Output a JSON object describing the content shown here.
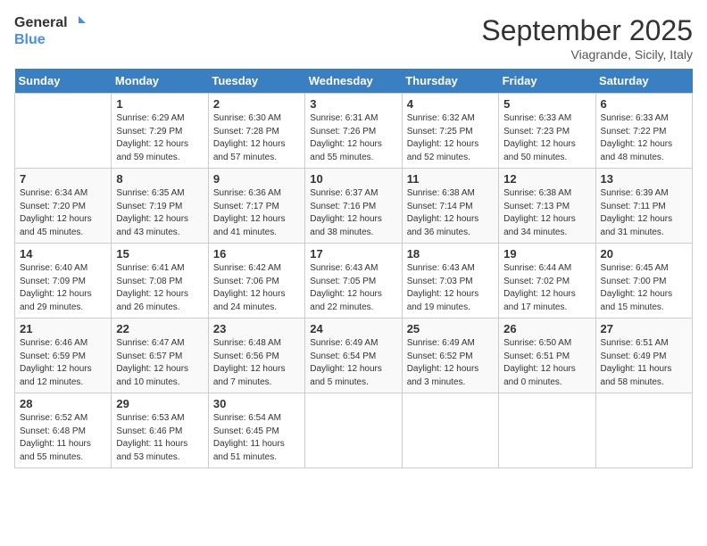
{
  "logo": {
    "general": "General",
    "blue": "Blue"
  },
  "title": "September 2025",
  "location": "Viagrande, Sicily, Italy",
  "weekdays": [
    "Sunday",
    "Monday",
    "Tuesday",
    "Wednesday",
    "Thursday",
    "Friday",
    "Saturday"
  ],
  "weeks": [
    [
      {
        "day": "",
        "info": ""
      },
      {
        "day": "1",
        "info": "Sunrise: 6:29 AM\nSunset: 7:29 PM\nDaylight: 12 hours\nand 59 minutes."
      },
      {
        "day": "2",
        "info": "Sunrise: 6:30 AM\nSunset: 7:28 PM\nDaylight: 12 hours\nand 57 minutes."
      },
      {
        "day": "3",
        "info": "Sunrise: 6:31 AM\nSunset: 7:26 PM\nDaylight: 12 hours\nand 55 minutes."
      },
      {
        "day": "4",
        "info": "Sunrise: 6:32 AM\nSunset: 7:25 PM\nDaylight: 12 hours\nand 52 minutes."
      },
      {
        "day": "5",
        "info": "Sunrise: 6:33 AM\nSunset: 7:23 PM\nDaylight: 12 hours\nand 50 minutes."
      },
      {
        "day": "6",
        "info": "Sunrise: 6:33 AM\nSunset: 7:22 PM\nDaylight: 12 hours\nand 48 minutes."
      }
    ],
    [
      {
        "day": "7",
        "info": "Sunrise: 6:34 AM\nSunset: 7:20 PM\nDaylight: 12 hours\nand 45 minutes."
      },
      {
        "day": "8",
        "info": "Sunrise: 6:35 AM\nSunset: 7:19 PM\nDaylight: 12 hours\nand 43 minutes."
      },
      {
        "day": "9",
        "info": "Sunrise: 6:36 AM\nSunset: 7:17 PM\nDaylight: 12 hours\nand 41 minutes."
      },
      {
        "day": "10",
        "info": "Sunrise: 6:37 AM\nSunset: 7:16 PM\nDaylight: 12 hours\nand 38 minutes."
      },
      {
        "day": "11",
        "info": "Sunrise: 6:38 AM\nSunset: 7:14 PM\nDaylight: 12 hours\nand 36 minutes."
      },
      {
        "day": "12",
        "info": "Sunrise: 6:38 AM\nSunset: 7:13 PM\nDaylight: 12 hours\nand 34 minutes."
      },
      {
        "day": "13",
        "info": "Sunrise: 6:39 AM\nSunset: 7:11 PM\nDaylight: 12 hours\nand 31 minutes."
      }
    ],
    [
      {
        "day": "14",
        "info": "Sunrise: 6:40 AM\nSunset: 7:09 PM\nDaylight: 12 hours\nand 29 minutes."
      },
      {
        "day": "15",
        "info": "Sunrise: 6:41 AM\nSunset: 7:08 PM\nDaylight: 12 hours\nand 26 minutes."
      },
      {
        "day": "16",
        "info": "Sunrise: 6:42 AM\nSunset: 7:06 PM\nDaylight: 12 hours\nand 24 minutes."
      },
      {
        "day": "17",
        "info": "Sunrise: 6:43 AM\nSunset: 7:05 PM\nDaylight: 12 hours\nand 22 minutes."
      },
      {
        "day": "18",
        "info": "Sunrise: 6:43 AM\nSunset: 7:03 PM\nDaylight: 12 hours\nand 19 minutes."
      },
      {
        "day": "19",
        "info": "Sunrise: 6:44 AM\nSunset: 7:02 PM\nDaylight: 12 hours\nand 17 minutes."
      },
      {
        "day": "20",
        "info": "Sunrise: 6:45 AM\nSunset: 7:00 PM\nDaylight: 12 hours\nand 15 minutes."
      }
    ],
    [
      {
        "day": "21",
        "info": "Sunrise: 6:46 AM\nSunset: 6:59 PM\nDaylight: 12 hours\nand 12 minutes."
      },
      {
        "day": "22",
        "info": "Sunrise: 6:47 AM\nSunset: 6:57 PM\nDaylight: 12 hours\nand 10 minutes."
      },
      {
        "day": "23",
        "info": "Sunrise: 6:48 AM\nSunset: 6:56 PM\nDaylight: 12 hours\nand 7 minutes."
      },
      {
        "day": "24",
        "info": "Sunrise: 6:49 AM\nSunset: 6:54 PM\nDaylight: 12 hours\nand 5 minutes."
      },
      {
        "day": "25",
        "info": "Sunrise: 6:49 AM\nSunset: 6:52 PM\nDaylight: 12 hours\nand 3 minutes."
      },
      {
        "day": "26",
        "info": "Sunrise: 6:50 AM\nSunset: 6:51 PM\nDaylight: 12 hours\nand 0 minutes."
      },
      {
        "day": "27",
        "info": "Sunrise: 6:51 AM\nSunset: 6:49 PM\nDaylight: 11 hours\nand 58 minutes."
      }
    ],
    [
      {
        "day": "28",
        "info": "Sunrise: 6:52 AM\nSunset: 6:48 PM\nDaylight: 11 hours\nand 55 minutes."
      },
      {
        "day": "29",
        "info": "Sunrise: 6:53 AM\nSunset: 6:46 PM\nDaylight: 11 hours\nand 53 minutes."
      },
      {
        "day": "30",
        "info": "Sunrise: 6:54 AM\nSunset: 6:45 PM\nDaylight: 11 hours\nand 51 minutes."
      },
      {
        "day": "",
        "info": ""
      },
      {
        "day": "",
        "info": ""
      },
      {
        "day": "",
        "info": ""
      },
      {
        "day": "",
        "info": ""
      }
    ]
  ]
}
